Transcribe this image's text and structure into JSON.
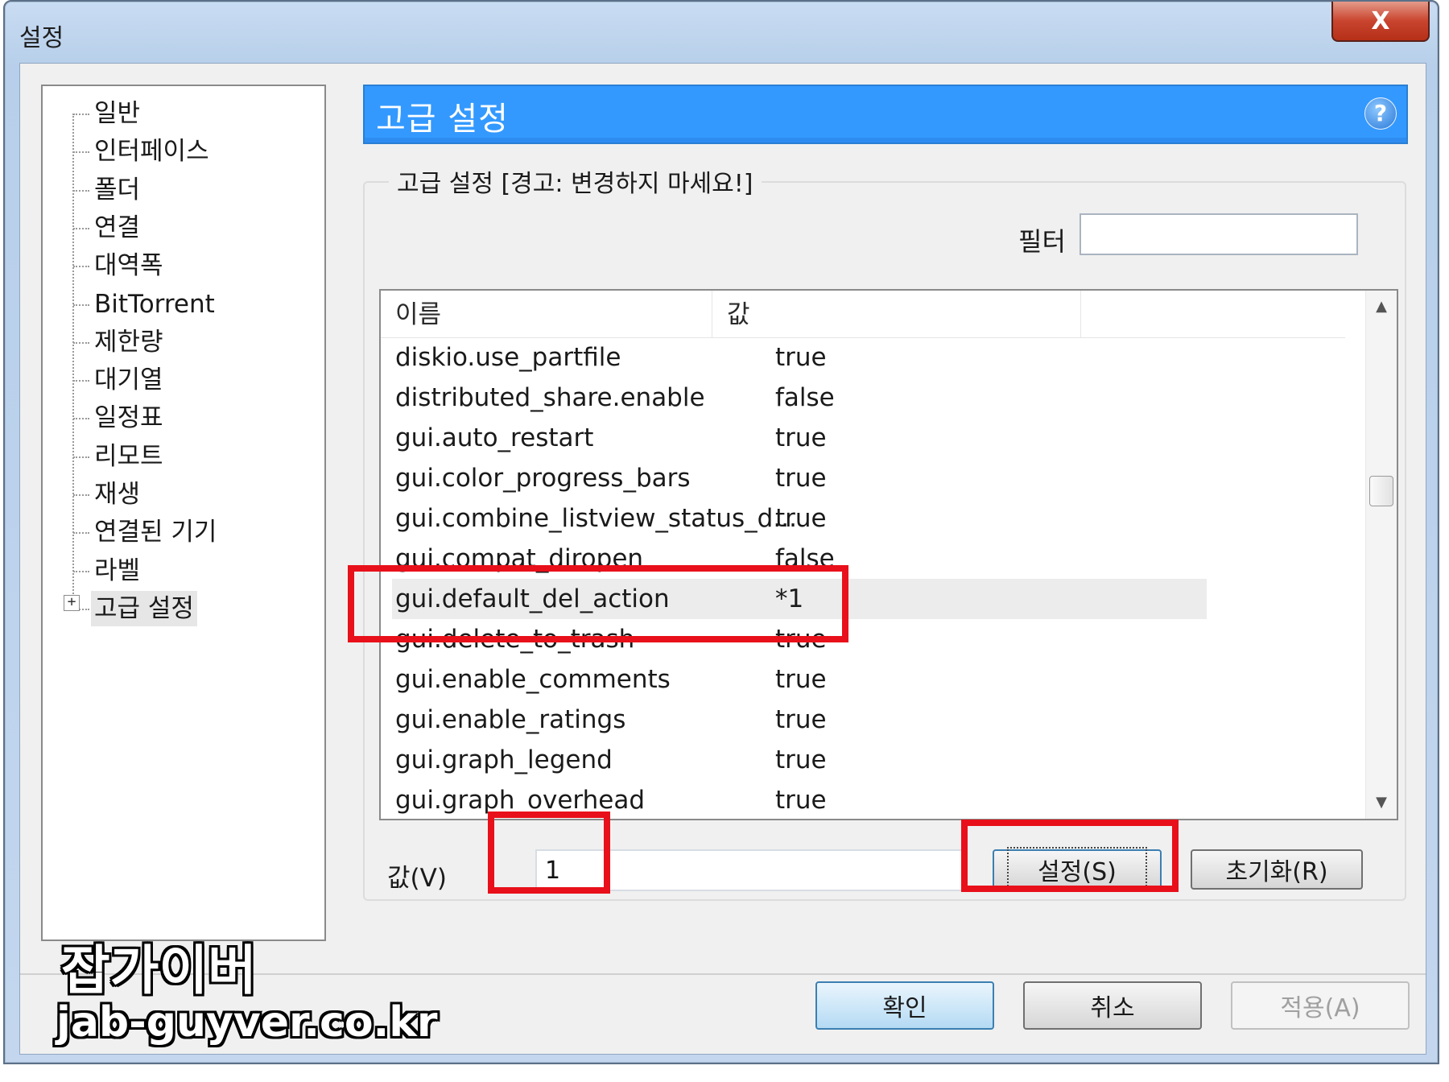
{
  "window": {
    "title": "설정",
    "close_label": "X"
  },
  "sidebar": {
    "items": [
      {
        "label": "일반"
      },
      {
        "label": "인터페이스"
      },
      {
        "label": "폴더"
      },
      {
        "label": "연결"
      },
      {
        "label": "대역폭"
      },
      {
        "label": "BitTorrent"
      },
      {
        "label": "제한량"
      },
      {
        "label": "대기열"
      },
      {
        "label": "일정표"
      },
      {
        "label": "리모트"
      },
      {
        "label": "재생"
      },
      {
        "label": "연결된 기기"
      },
      {
        "label": "라벨"
      },
      {
        "label": "고급 설정",
        "selected": true,
        "expander": "+"
      }
    ]
  },
  "header": {
    "title": "고급 설정",
    "help_icon": "?"
  },
  "group": {
    "legend": "고급 설정 [경고: 변경하지 마세요!]"
  },
  "filter": {
    "label": "필터",
    "value": ""
  },
  "table": {
    "columns": [
      "이름",
      "값"
    ],
    "rows": [
      {
        "name": "diskio.use_partfile",
        "value": "true"
      },
      {
        "name": "distributed_share.enable",
        "value": "false"
      },
      {
        "name": "gui.auto_restart",
        "value": "true"
      },
      {
        "name": "gui.color_progress_bars",
        "value": "true"
      },
      {
        "name": "gui.combine_listview_status_d...",
        "value": "true"
      },
      {
        "name": "gui.compat_diropen",
        "value": "false"
      },
      {
        "name": "gui.default_del_action",
        "value": "*1",
        "selected": true
      },
      {
        "name": "gui.delete_to_trash",
        "value": "true"
      },
      {
        "name": "gui.enable_comments",
        "value": "true"
      },
      {
        "name": "gui.enable_ratings",
        "value": "true"
      },
      {
        "name": "gui.graph_legend",
        "value": "true"
      },
      {
        "name": "gui.graph_overhead",
        "value": "true"
      }
    ]
  },
  "value_editor": {
    "label": "값(V)",
    "value": "1",
    "set_label": "설정(S)",
    "reset_label": "초기화(R)"
  },
  "footer": {
    "ok_label": "확인",
    "cancel_label": "취소",
    "apply_label": "적용(A)"
  },
  "watermark": {
    "title": "잡가이버",
    "url": "jab-guyver.co.kr"
  },
  "colors": {
    "header_bg": "#3399ff",
    "highlight": "#e8101a",
    "selected_row": "#ececec"
  }
}
